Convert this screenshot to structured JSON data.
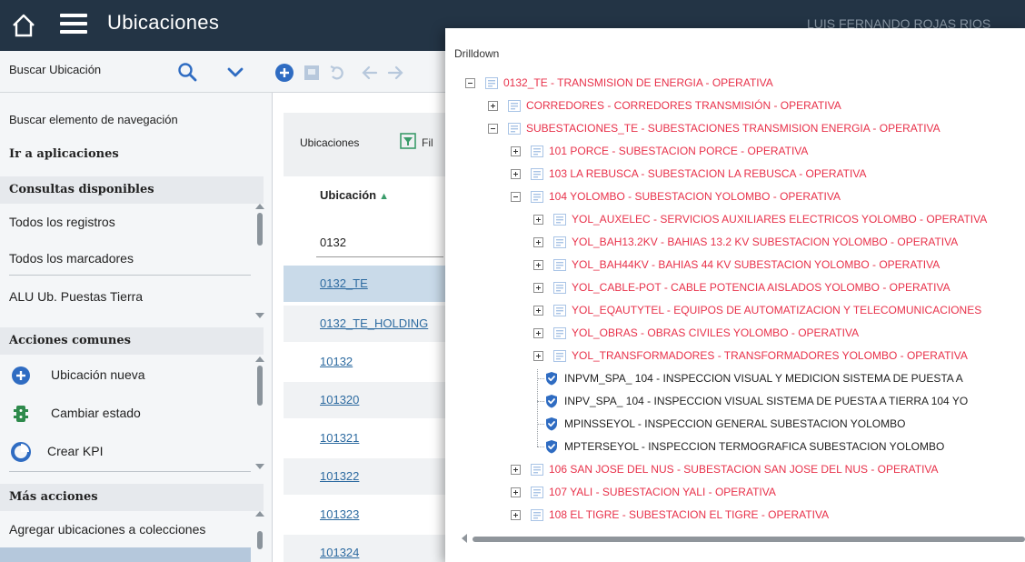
{
  "header": {
    "title": "Ubicaciones",
    "user": "LUIS FERNANDO ROJAS RIOS"
  },
  "search": {
    "placeholder": "Buscar Ubicación"
  },
  "sidebar": {
    "nav_search": "Buscar elemento de navegación",
    "go_to_apps": "Ir a aplicaciones",
    "queries_header": "Consultas disponibles",
    "queries": [
      "Todos los registros",
      "Todos los marcadores",
      "ALU Ub. Puestas Tierra"
    ],
    "common_header": "Acciones comunes",
    "common_actions": [
      "Ubicación nueva",
      "Cambiar estado",
      "Crear KPI"
    ],
    "more_header": "Más acciones",
    "more_actions": [
      "Agregar ubicaciones a colecciones"
    ]
  },
  "main": {
    "breadcrumb": "Ubicaciones",
    "filter_label": "Fil",
    "column_header": "Ubicación",
    "filter_value": "0132",
    "rows": [
      "0132_TE",
      "0132_TE_HOLDING",
      "10132",
      "101320",
      "101321",
      "101322",
      "101323",
      "101324"
    ]
  },
  "drilldown": {
    "title": "Drilldown",
    "nodes": [
      {
        "text": "0132_TE - TRANSMISION DE ENERGIA - OPERATIVA",
        "status": "red",
        "expanded": true
      },
      {
        "text": "CORREDORES - CORREDORES TRANSMISIÓN - OPERATIVA",
        "status": "red",
        "expanded": false
      },
      {
        "text": "SUBESTACIONES_TE - SUBESTACIONES TRANSMISION ENERGIA - OPERATIVA",
        "status": "red",
        "expanded": true
      },
      {
        "text": "101 PORCE - SUBESTACION PORCE - OPERATIVA",
        "status": "red",
        "expanded": false
      },
      {
        "text": "103 LA REBUSCA - SUBESTACION LA REBUSCA - OPERATIVA",
        "status": "red",
        "expanded": false
      },
      {
        "text": "104 YOLOMBO - SUBESTACION YOLOMBO - OPERATIVA",
        "status": "red",
        "expanded": true
      },
      {
        "text": "YOL_AUXELEC - SERVICIOS AUXILIARES ELECTRICOS YOLOMBO - OPERATIVA",
        "status": "red",
        "expanded": false
      },
      {
        "text": "YOL_BAH13.2KV - BAHIAS 13.2 KV SUBESTACION YOLOMBO - OPERATIVA",
        "status": "red",
        "expanded": false
      },
      {
        "text": "YOL_BAH44KV - BAHIAS 44 KV SUBESTACION YOLOMBO - OPERATIVA",
        "status": "red",
        "expanded": false
      },
      {
        "text": "YOL_CABLE-POT - CABLE POTENCIA AISLADOS YOLOMBO - OPERATIVA",
        "status": "red",
        "expanded": false
      },
      {
        "text": "YOL_EQAUTYTEL - EQUIPOS DE AUTOMATIZACION Y TELECOMUNICACIONES",
        "status": "red",
        "expanded": false
      },
      {
        "text": "YOL_OBRAS - OBRAS CIVILES YOLOMBO - OPERATIVA",
        "status": "red",
        "expanded": false
      },
      {
        "text": "YOL_TRANSFORMADORES - TRANSFORMADORES YOLOMBO - OPERATIVA",
        "status": "red",
        "expanded": false
      },
      {
        "text": "INPVM_SPA_ 104 - INSPECCION VISUAL Y MEDICION SISTEMA DE PUESTA A",
        "status": "check"
      },
      {
        "text": "INPV_SPA_ 104 - INSPECCION VISUAL SISTEMA DE PUESTA A TIERRA 104 YO",
        "status": "check"
      },
      {
        "text": "MPINSSEYOL - INSPECCION GENERAL SUBESTACION YOLOMBO",
        "status": "check"
      },
      {
        "text": "MPTERSEYOL - INSPECCION TERMOGRAFICA SUBESTACION YOLOMBO",
        "status": "check"
      },
      {
        "text": "106 SAN JOSE DEL NUS - SUBESTACION SAN JOSE DEL NUS - OPERATIVA",
        "status": "red",
        "expanded": false
      },
      {
        "text": "107 YALI - SUBESTACION YALI - OPERATIVA",
        "status": "red",
        "expanded": false
      },
      {
        "text": "108 EL TIGRE - SUBESTACION EL TIGRE - OPERATIVA",
        "status": "red",
        "expanded": false
      }
    ]
  },
  "colors": {
    "header_bg": "#233445",
    "accent_blue": "#2f6cc2",
    "status_red": "#e8314a",
    "row_highlight": "#c9dae9"
  },
  "icons": [
    "home-icon",
    "menu-icon",
    "search-icon",
    "chevron-down-icon",
    "add-icon",
    "filter-icon",
    "location-icon",
    "check-badge-icon"
  ]
}
